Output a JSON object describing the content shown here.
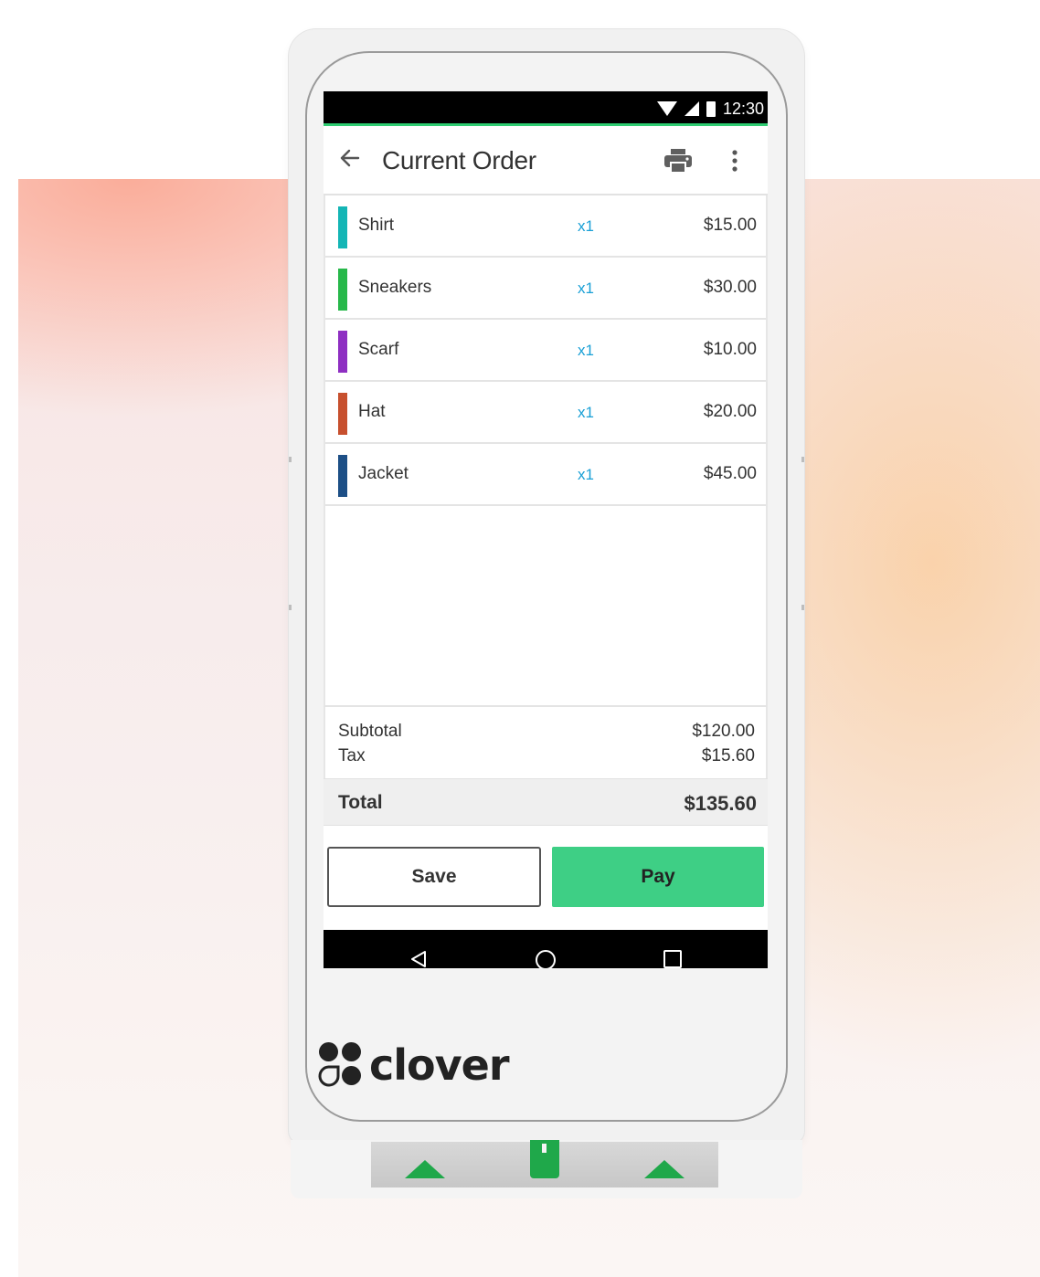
{
  "status_bar": {
    "time": "12:30"
  },
  "header": {
    "title": "Current Order"
  },
  "order_items": [
    {
      "name": "Shirt",
      "qty": "x1",
      "price": "$15.00",
      "color": "#14b5b5"
    },
    {
      "name": "Sneakers",
      "qty": "x1",
      "price": "$30.00",
      "color": "#27b84a"
    },
    {
      "name": "Scarf",
      "qty": "x1",
      "price": "$10.00",
      "color": "#8e2fc2"
    },
    {
      "name": "Hat",
      "qty": "x1",
      "price": "$20.00",
      "color": "#c7502e"
    },
    {
      "name": "Jacket",
      "qty": "x1",
      "price": "$45.00",
      "color": "#1d4f86"
    }
  ],
  "summary": {
    "subtotal_label": "Subtotal",
    "subtotal_value": "$120.00",
    "tax_label": "Tax",
    "tax_value": "$15.60",
    "total_label": "Total",
    "total_value": "$135.60"
  },
  "actions": {
    "save_label": "Save",
    "pay_label": "Pay"
  },
  "brand": {
    "name": "clover"
  },
  "colors": {
    "accent_green": "#3ecf85",
    "qty_blue": "#1aa0d6",
    "status_line_green": "#2ecc71"
  },
  "icons": {
    "back": "arrow-left-icon",
    "print": "printer-icon",
    "more": "more-vertical-icon",
    "wifi": "wifi-icon",
    "signal": "cell-signal-icon",
    "battery": "battery-icon",
    "nav_back": "nav-back-icon",
    "nav_home": "nav-home-icon",
    "nav_recents": "nav-recents-icon"
  }
}
